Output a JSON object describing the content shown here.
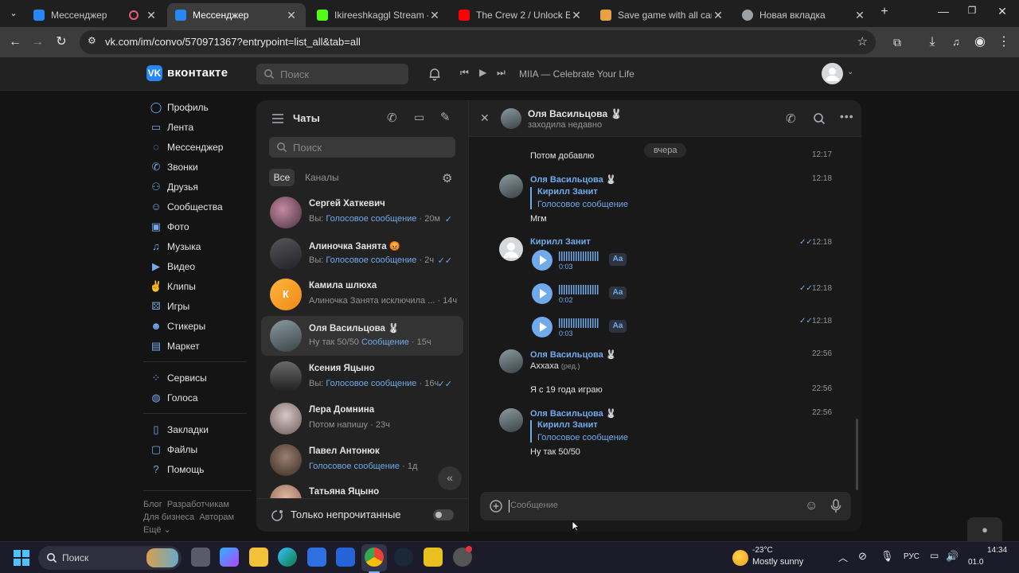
{
  "browser": {
    "tabs": [
      {
        "title": "Мессенджер",
        "color": "#2787f5"
      },
      {
        "title": "Мессенджер",
        "color": "#2787f5"
      },
      {
        "title": "Ikireeshkaggl Stream - Wa",
        "color": "#53fc18"
      },
      {
        "title": "The Crew 2 / Unlock Everyt",
        "color": "#ff0000"
      },
      {
        "title": "Save game with all cars an",
        "color": "#e8a040"
      },
      {
        "title": "Новая вкладка",
        "color": "#9aa0a6"
      }
    ],
    "url": "vk.com/im/convo/570971367?entrypoint=list_all&tab=all"
  },
  "vk_header": {
    "logo_text": "вконтакте",
    "search_placeholder": "Поиск",
    "player_text": "MIIA — Celebrate Your Life"
  },
  "left_nav": {
    "main": [
      {
        "label": "Профиль",
        "icon": "user-icon"
      },
      {
        "label": "Лента",
        "icon": "feed-icon"
      },
      {
        "label": "Мессенджер",
        "icon": "chat-icon"
      },
      {
        "label": "Звонки",
        "icon": "phone-icon"
      },
      {
        "label": "Друзья",
        "icon": "friends-icon"
      },
      {
        "label": "Сообщества",
        "icon": "communities-icon"
      },
      {
        "label": "Фото",
        "icon": "photo-icon"
      },
      {
        "label": "Музыка",
        "icon": "music-icon"
      },
      {
        "label": "Видео",
        "icon": "video-icon"
      },
      {
        "label": "Клипы",
        "icon": "clips-icon"
      },
      {
        "label": "Игры",
        "icon": "games-icon"
      },
      {
        "label": "Стикеры",
        "icon": "stickers-icon"
      },
      {
        "label": "Маркет",
        "icon": "market-icon"
      }
    ],
    "services": [
      {
        "label": "Сервисы",
        "icon": "services-icon"
      },
      {
        "label": "Голоса",
        "icon": "votes-icon"
      }
    ],
    "extra": [
      {
        "label": "Закладки",
        "icon": "bookmark-icon"
      },
      {
        "label": "Файлы",
        "icon": "files-icon"
      },
      {
        "label": "Помощь",
        "icon": "help-icon"
      }
    ],
    "footer": {
      "line1a": "Блог",
      "line1b": "Разработчикам",
      "line2a": "Для бизнеса",
      "line2b": "Авторам",
      "line3": "Ещё ⌄"
    }
  },
  "chat_list": {
    "title": "Чаты",
    "search_placeholder": "Поиск",
    "filter_all": "Все",
    "filter_channels": "Каналы",
    "unread_only": "Только непрочитанные",
    "items": [
      {
        "name": "Сергей Хаткевич",
        "prefix": "Вы: ",
        "preview_blue": "Голосовое сообщение",
        "preview": "",
        "time": " · 20м",
        "read": "✓",
        "avatar": "#7a5a6a"
      },
      {
        "name": "Алиночка Занята 😡",
        "prefix": "Вы: ",
        "preview_blue": "Голосовое сообщение",
        "preview": "",
        "time": " · 2ч",
        "read": "✓✓",
        "avatar": "#3a3a3e"
      },
      {
        "name": "Камила шлюха",
        "prefix": "",
        "preview_blue": "",
        "preview": "Алиночка Занята исключила ...",
        "time": " · 14ч",
        "read": "",
        "avatar": "#f5a623",
        "initial": "К"
      },
      {
        "name": "Оля Васильцова 🐰",
        "prefix": "",
        "preview_blue": "",
        "preview": "Ну так 50/50 ",
        "preview_blue2": "Сообщение",
        "time": " · 15ч",
        "read": "",
        "avatar": "#5a6a70"
      },
      {
        "name": "Ксения Яцыно",
        "prefix": "Вы: ",
        "preview_blue": "Голосовое сообщение",
        "preview": "",
        "time": " · 16ч",
        "read": "✓✓",
        "avatar": "#4a4a4a"
      },
      {
        "name": "Лера Домнина",
        "prefix": "",
        "preview_blue": "",
        "preview": "Потом напишу",
        "time": " · 23ч",
        "read": "",
        "avatar": "#8a7a78"
      },
      {
        "name": "Павел Антонюк",
        "prefix": "",
        "preview_blue": "Голосовое сообщение",
        "preview": "",
        "time": " · 1д",
        "read": "",
        "avatar": "#5a4a3a"
      },
      {
        "name": "Татьяна Яцыно",
        "prefix": "",
        "preview_blue": "",
        "preview": "",
        "time": "",
        "read": "",
        "avatar": "#a08070"
      }
    ]
  },
  "conversation": {
    "peer_name": "Оля Васильцова 🐰",
    "peer_status": "заходила недавно",
    "date_chip": "вчера",
    "messages": {
      "m0_text": "Потом добавлю",
      "m0_time": "12:17",
      "m1_author": "Оля Васильцова 🐰",
      "m1_time": "12:18",
      "m1_reply_author": "Кирилл Занит",
      "m1_reply_text": "Голосовое сообщение",
      "m1_text": "Мгм",
      "m2_author": "Кирилл Занит",
      "voices": [
        {
          "duration": "0:03",
          "time": "12:18"
        },
        {
          "duration": "0:02",
          "time": "12:18"
        },
        {
          "duration": "0:03",
          "time": "12:18"
        }
      ],
      "aa_label": "Aa",
      "m3_author": "Оля Васильцова 🐰",
      "m3_time": "22:56",
      "m3_text": "Аххаха",
      "m3_edited": "(ред.)",
      "m4_text": "Я с 19 года играю",
      "m4_time": "22:56",
      "m5_author": "Оля Васильцова 🐰",
      "m5_time": "22:56",
      "m5_reply_author": "Кирилл Занит",
      "m5_reply_text": "Голосовое сообщение",
      "m5_text": "Ну так 50/50"
    },
    "composer_placeholder": "Сообщение"
  },
  "taskbar": {
    "search_placeholder": "Поиск",
    "weather_temp": "-23°C",
    "weather_desc": "Mostly sunny",
    "lang": "РУС",
    "time": "14:34",
    "date": "01.0"
  }
}
